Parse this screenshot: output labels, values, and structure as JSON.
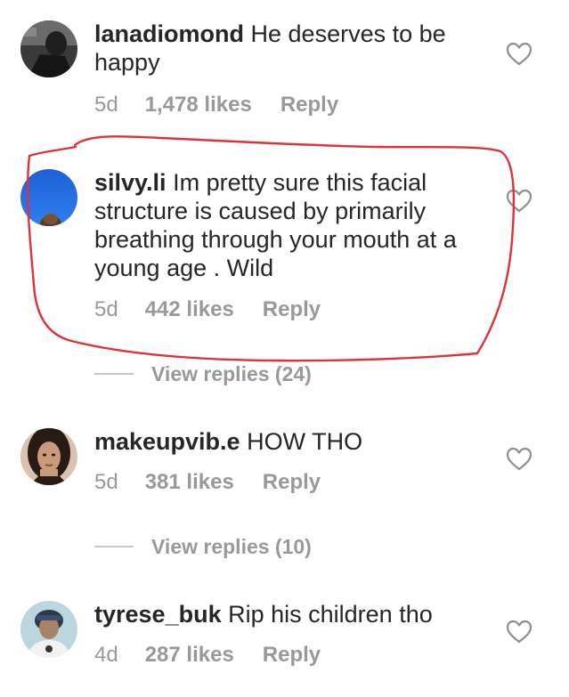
{
  "comments": [
    {
      "username": "lanadiomond",
      "text": "He deserves to be happy",
      "time": "5d",
      "likes": "1,478 likes",
      "reply": "Reply",
      "avatar_icon": "avatar-photo-dark"
    },
    {
      "username": "silvy.li",
      "text": "Im pretty sure this facial structure is caused by primarily breathing through your mouth at a young age . Wild",
      "time": "5d",
      "likes": "442 likes",
      "reply": "Reply",
      "avatar_icon": "avatar-photo-blue-sky",
      "view_replies": "View replies (24)"
    },
    {
      "username": "makeupvib.e",
      "text": "HOW THO",
      "time": "5d",
      "likes": "381 likes",
      "reply": "Reply",
      "avatar_icon": "avatar-photo-portrait",
      "view_replies": "View replies (10)"
    },
    {
      "username": "tyrese_buk",
      "text": "Rip his children tho",
      "time": "4d",
      "likes": "287 likes",
      "reply": "Reply",
      "avatar_icon": "avatar-photo-person"
    }
  ],
  "colors": {
    "text": "#262626",
    "meta": "#999999",
    "annotation": "#e0303a"
  },
  "icons": {
    "like": "heart-outline-icon"
  }
}
